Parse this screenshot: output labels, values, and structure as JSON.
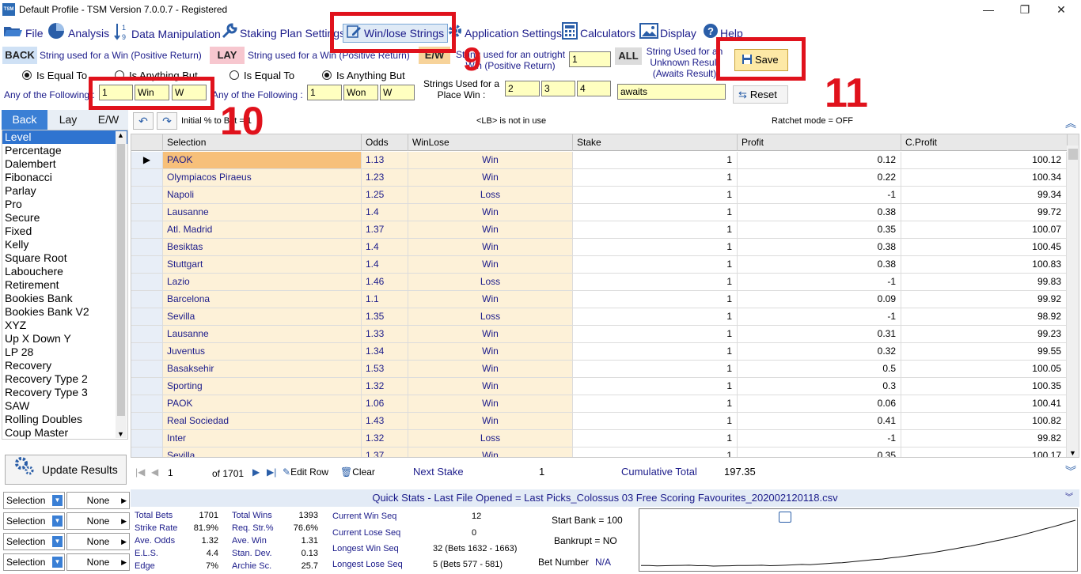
{
  "window": {
    "title": "Default Profile  -  TSM Version 7.0.0.7 - Registered",
    "logo": "TSM",
    "minimize": "—",
    "maximize": "❐",
    "close": "✕"
  },
  "menu": [
    {
      "label": "File",
      "icon": "folder-icon"
    },
    {
      "label": "Analysis",
      "icon": "pie-chart-icon"
    },
    {
      "label": "Data Manipulation",
      "icon": "sort-numeric-icon"
    },
    {
      "label": "Staking Plan Settings",
      "icon": "wrench-icon"
    },
    {
      "label": "Win/lose Strings",
      "icon": "pencil-icon"
    },
    {
      "label": "Application Settings",
      "icon": "gear-icon"
    },
    {
      "label": "Calculators",
      "icon": "calculator-icon"
    },
    {
      "label": "Display",
      "icon": "image-icon"
    },
    {
      "label": "Help",
      "icon": "help-icon"
    }
  ],
  "settings": {
    "back": {
      "tag": "BACK",
      "caption": "String used for a Win (Positive Return)",
      "opt1": "Is Equal To",
      "opt2": "Is Anything But",
      "selected": 1,
      "anyof": "Any of the Following :",
      "values": [
        "1",
        "Win",
        "W"
      ]
    },
    "lay": {
      "tag": "LAY",
      "caption": "String used for a Win (Positive Return)",
      "opt1": "Is Equal To",
      "opt2": "Is Anything But",
      "selected": 2,
      "anyof": "Any of the Following :",
      "values": [
        "1",
        "Won",
        "W"
      ]
    },
    "ew": {
      "tag": "E/W",
      "caption": "String used for an outright Win (Positive Return)",
      "value": "1",
      "place_label": "Strings Used for a Place Win :",
      "place_values": [
        "2",
        "3",
        "4"
      ]
    },
    "all": {
      "tag": "ALL",
      "caption": "String Used for an Unknown Result (Awaits Result)",
      "value": "awaits"
    },
    "save": "Save",
    "reset": "Reset"
  },
  "annotations": {
    "n9": "9",
    "n10": "10",
    "n11": "11"
  },
  "plan_tabs": [
    "Back",
    "Lay",
    "E/W"
  ],
  "plans": [
    "Level",
    "Percentage",
    "Dalembert",
    "Fibonacci",
    "Parlay",
    "Pro",
    "Secure",
    "Fixed",
    "Kelly",
    "Square Root",
    "Labouchere",
    "Retirement",
    "Bookies Bank",
    "Bookies Bank V2",
    "XYZ",
    "Up X Down Y",
    "LP 28",
    "Recovery",
    "Recovery Type 2",
    "Recovery Type 3",
    "SAW",
    "Rolling Doubles",
    "Coup Master"
  ],
  "update_button": "Update Results",
  "filters": [
    {
      "sel": "Selection",
      "val": "None"
    },
    {
      "sel": "Selection",
      "val": "None"
    },
    {
      "sel": "Selection",
      "val": "None"
    },
    {
      "sel": "Selection",
      "val": "None"
    }
  ],
  "toolbar": {
    "initial": "Initial % to Bet = 1",
    "lb": "<LB> is not in use",
    "ratchet": "Ratchet mode = OFF"
  },
  "grid": {
    "columns": [
      "Selection",
      "Odds",
      "WinLose",
      "Stake",
      "Profit",
      "C.Profit"
    ],
    "rows": [
      [
        "PAOK",
        "1.13",
        "Win",
        "1",
        "0.12",
        "100.12"
      ],
      [
        "Olympiacos Piraeus",
        "1.23",
        "Win",
        "1",
        "0.22",
        "100.34"
      ],
      [
        "Napoli",
        "1.25",
        "Loss",
        "1",
        "-1",
        "99.34"
      ],
      [
        "Lausanne",
        "1.4",
        "Win",
        "1",
        "0.38",
        "99.72"
      ],
      [
        "Atl. Madrid",
        "1.37",
        "Win",
        "1",
        "0.35",
        "100.07"
      ],
      [
        "Besiktas",
        "1.4",
        "Win",
        "1",
        "0.38",
        "100.45"
      ],
      [
        "Stuttgart",
        "1.4",
        "Win",
        "1",
        "0.38",
        "100.83"
      ],
      [
        "Lazio",
        "1.46",
        "Loss",
        "1",
        "-1",
        "99.83"
      ],
      [
        "Barcelona",
        "1.1",
        "Win",
        "1",
        "0.09",
        "99.92"
      ],
      [
        "Sevilla",
        "1.35",
        "Loss",
        "1",
        "-1",
        "98.92"
      ],
      [
        "Lausanne",
        "1.33",
        "Win",
        "1",
        "0.31",
        "99.23"
      ],
      [
        "Juventus",
        "1.34",
        "Win",
        "1",
        "0.32",
        "99.55"
      ],
      [
        "Basaksehir",
        "1.53",
        "Win",
        "1",
        "0.5",
        "100.05"
      ],
      [
        "Sporting",
        "1.32",
        "Win",
        "1",
        "0.3",
        "100.35"
      ],
      [
        "PAOK",
        "1.06",
        "Win",
        "1",
        "0.06",
        "100.41"
      ],
      [
        "Real Sociedad",
        "1.43",
        "Win",
        "1",
        "0.41",
        "100.82"
      ],
      [
        "Inter",
        "1.32",
        "Loss",
        "1",
        "-1",
        "99.82"
      ],
      [
        "Sevilla",
        "1.37",
        "Win",
        "1",
        "0.35",
        "100.17"
      ]
    ]
  },
  "nav": {
    "record": "1",
    "of": "of 1701",
    "edit": "Edit Row",
    "clear": "Clear",
    "next_stake_label": "Next Stake",
    "next_stake": "1",
    "cum_label": "Cumulative Total",
    "cum": "197.35"
  },
  "quickstats": {
    "title": "Quick Stats - Last File Opened = Last Picks_Colossus 03 Free Scoring Favourites_202002120118.csv",
    "col1": [
      [
        "Total Bets",
        "1701"
      ],
      [
        "Strike Rate",
        "81.9%"
      ],
      [
        "Ave. Odds",
        "1.32"
      ],
      [
        "E.L.S.",
        "4.4"
      ],
      [
        "Edge",
        "7%"
      ]
    ],
    "col2": [
      [
        "Total Wins",
        "1393"
      ],
      [
        "Req. Str.%",
        "76.6%"
      ],
      [
        "Ave. Win",
        "1.31"
      ],
      [
        "Stan. Dev.",
        "0.13"
      ],
      [
        "Archie Sc.",
        "25.7"
      ]
    ],
    "col3": [
      [
        "Current Win Seq",
        "12"
      ],
      [
        "Current Lose Seq",
        "0"
      ],
      [
        "Longest Win Seq",
        "32  (Bets 1632 - 1663)"
      ],
      [
        "Longest Lose Seq",
        "5  (Bets 577 - 581)"
      ]
    ],
    "start_bank": "Start Bank = 100",
    "bankrupt": "Bankrupt = NO",
    "betnum_label": "Bet Number",
    "betnum": "N/A"
  },
  "spark_data": [
    100.12,
    100.34,
    99.34,
    99.72,
    100.07,
    100.45,
    100.83,
    99.83,
    99.92,
    98.92,
    99.23,
    99.55,
    100.05,
    100.35,
    100.41,
    100.82,
    99.82,
    100.17,
    100.8,
    101.6,
    102.4,
    101.9,
    103.1,
    104.2,
    105.5,
    106.3,
    107.9,
    109.4,
    111.2,
    112.8,
    114.1,
    116.5,
    118.2,
    120.6,
    122.8,
    125.1,
    127.4,
    130.2,
    133.0,
    136.1,
    139.3,
    142.0,
    145.6,
    149.2,
    152.8,
    156.1,
    160.4,
    164.0,
    168.7,
    173.2,
    178.0,
    182.5,
    187.1,
    192.4,
    197.35
  ]
}
